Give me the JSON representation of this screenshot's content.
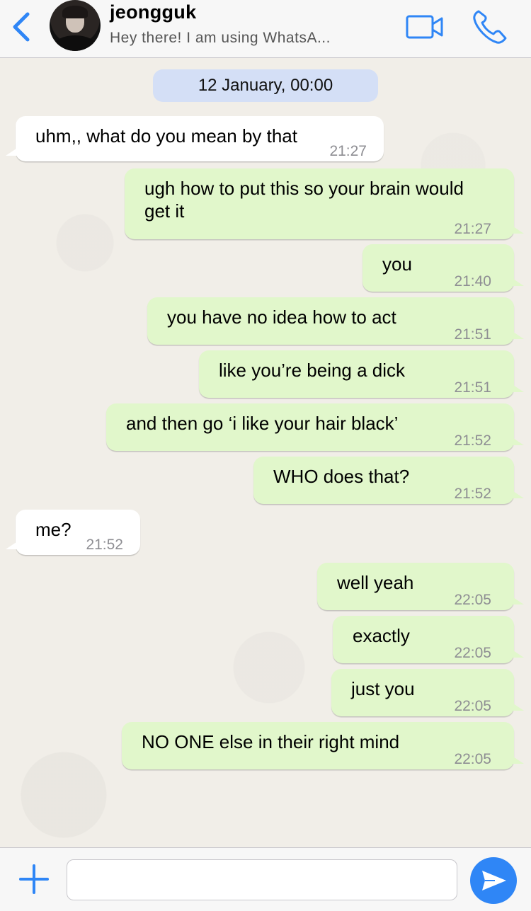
{
  "header": {
    "contact_name": "jeongguk",
    "status": "Hey there! I am using WhatsA...",
    "back_icon": "chevron-left-icon",
    "video_icon": "video-camera-icon",
    "call_icon": "phone-icon"
  },
  "colors": {
    "accent": "#2f86f6",
    "incoming_bubble": "#ffffff",
    "outgoing_bubble": "#e1f7cb",
    "date_pill": "#d4dff6",
    "chat_background": "#f1eee8"
  },
  "chat": {
    "date_label": "12 January, 00:00",
    "messages": [
      {
        "direction": "in",
        "text": "uhm,, what do you mean by that",
        "time": "21:27"
      },
      {
        "direction": "out",
        "text": "ugh how to put this so your brain would\nget it",
        "time": "21:27"
      },
      {
        "direction": "out",
        "text": "you",
        "time": "21:40"
      },
      {
        "direction": "out",
        "text": "you have no idea how to act",
        "time": "21:51"
      },
      {
        "direction": "out",
        "text": "like you’re being a dick",
        "time": "21:51"
      },
      {
        "direction": "out",
        "text": "and then go ‘i like your hair black’",
        "time": "21:52"
      },
      {
        "direction": "out",
        "text": "WHO does that?",
        "time": "21:52"
      },
      {
        "direction": "in",
        "text": "me?",
        "time": "21:52"
      },
      {
        "direction": "out",
        "text": "well yeah",
        "time": "22:05"
      },
      {
        "direction": "out",
        "text": "exactly",
        "time": "22:05"
      },
      {
        "direction": "out",
        "text": "just you",
        "time": "22:05"
      },
      {
        "direction": "out",
        "text": "NO ONE else in their right mind",
        "time": "22:05"
      }
    ]
  },
  "input_bar": {
    "plus_icon": "plus-icon",
    "message_value": "",
    "send_icon": "send-arrow-icon"
  }
}
